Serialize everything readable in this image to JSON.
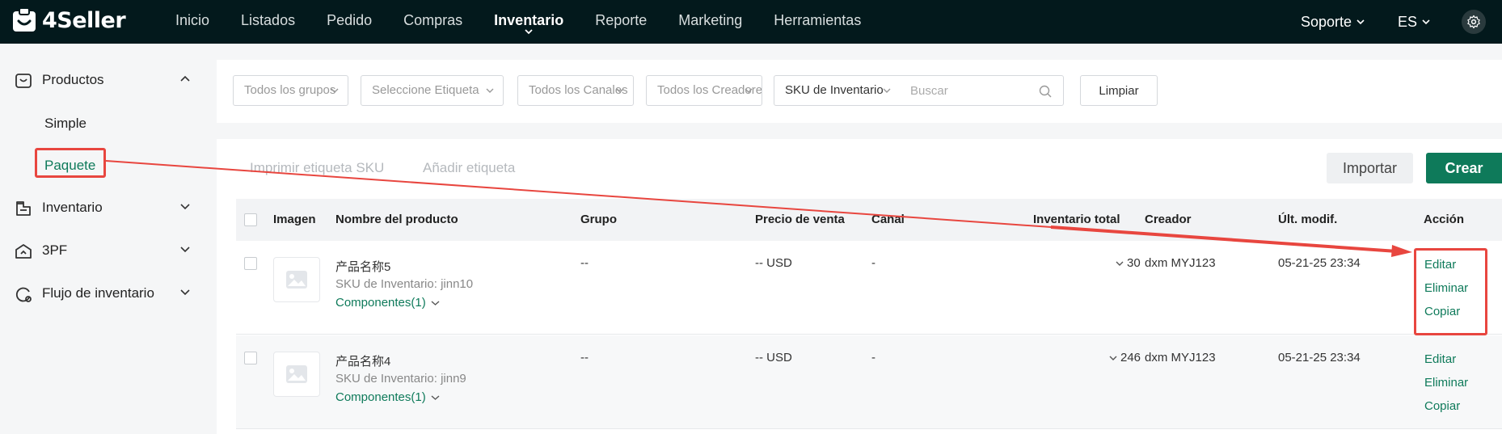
{
  "app": {
    "logo_text": "4Seller",
    "brand_color": "#0e7a5a",
    "topbar_color": "#03191c"
  },
  "nav": {
    "items": [
      "Inicio",
      "Listados",
      "Pedido",
      "Compras",
      "Inventario",
      "Reporte",
      "Marketing",
      "Herramientas"
    ],
    "active": "Inventario",
    "support_label": "Soporte",
    "language_label": "ES",
    "settings_icon": "gear-icon"
  },
  "sidebar": {
    "groups": [
      {
        "label": "Productos",
        "icon": "product-box-icon",
        "expanded": true
      },
      {
        "label": "Inventario",
        "icon": "inventory-list-icon",
        "expanded": false
      },
      {
        "label": "3PF",
        "icon": "warehouse-icon",
        "expanded": false
      },
      {
        "label": "Flujo de inventario",
        "icon": "flow-icon",
        "expanded": false
      }
    ],
    "sub_items": [
      {
        "label": "Simple",
        "active": false
      },
      {
        "label": "Paquete",
        "active": true
      }
    ]
  },
  "filters": {
    "group_select": "Todos los grupos",
    "tag_select": "Seleccione Etiqueta",
    "channel_select": "Todos los Canales",
    "creator_select": "Todos los Creadores",
    "search_field_select": "SKU de Inventario",
    "search_placeholder": "Buscar",
    "clear_label": "Limpiar"
  },
  "toolbar": {
    "print_sku_label": "Imprimir etiqueta SKU",
    "add_tag_label": "Añadir etiqueta",
    "import_label": "Importar",
    "create_label": "Crear"
  },
  "table": {
    "columns": [
      "Imagen",
      "Nombre del producto",
      "Grupo",
      "Precio de venta",
      "Canal",
      "Inventario total",
      "Creador",
      "Últ. modif.",
      "Acción"
    ],
    "rows": [
      {
        "name": "产品名称5",
        "sku": "SKU de Inventario: jinn10",
        "components": "Componentes(1)",
        "group": "--",
        "price": "-- USD",
        "channel": "-",
        "total": "30",
        "creator": "dxm MYJ123",
        "modified": "05-21-25 23:34",
        "actions": [
          "Editar",
          "Eliminar",
          "Copiar"
        ]
      },
      {
        "name": "产品名称4",
        "sku": "SKU de Inventario: jinn9",
        "components": "Componentes(1)",
        "group": "--",
        "price": "-- USD",
        "channel": "-",
        "total": "246",
        "creator": "dxm MYJ123",
        "modified": "05-21-25 23:34",
        "actions": [
          "Editar",
          "Eliminar",
          "Copiar"
        ]
      }
    ]
  },
  "annotation_color": "#e8463f"
}
